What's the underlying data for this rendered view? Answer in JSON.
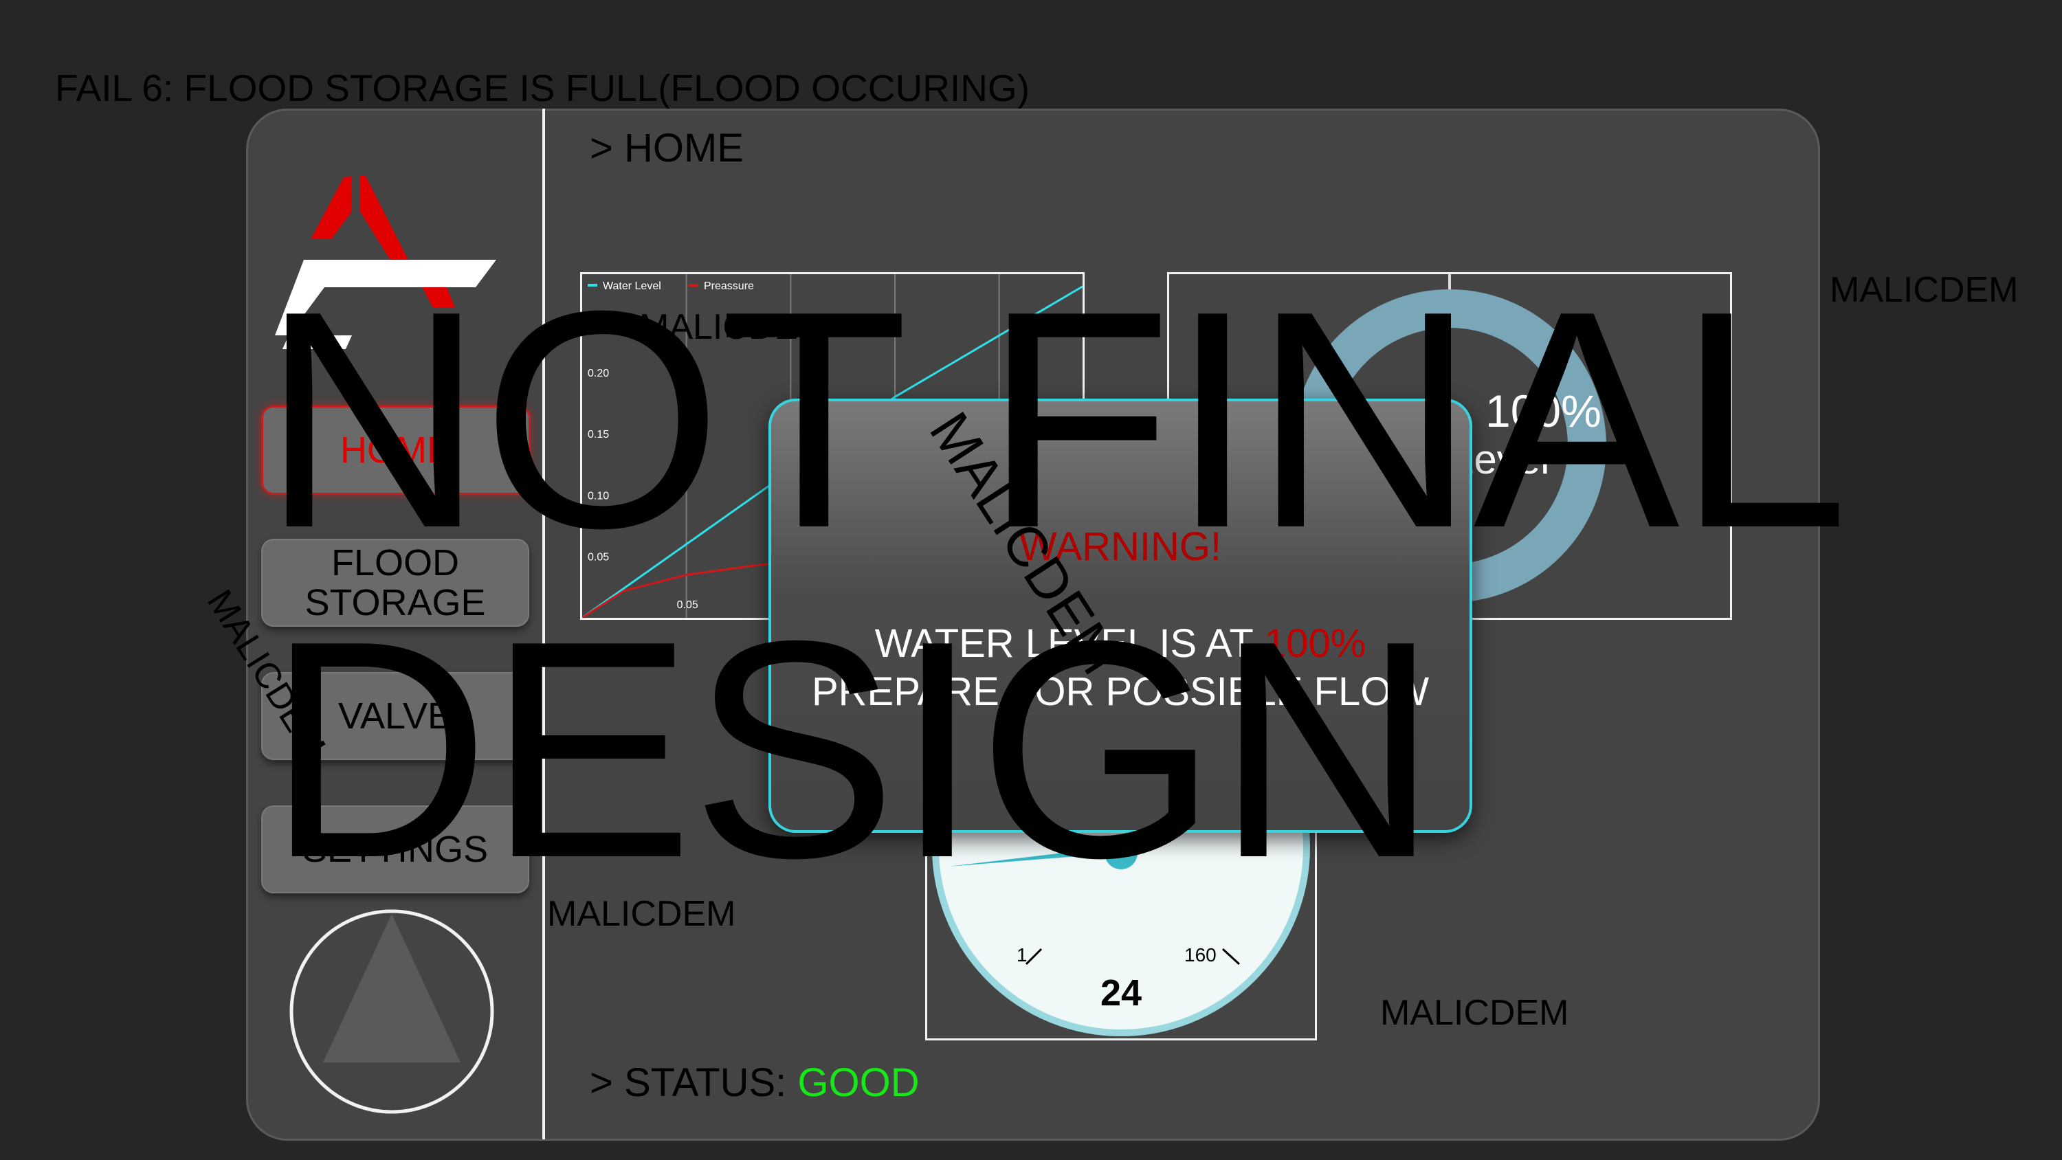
{
  "caption": "FAIL 6: FLOOD STORAGE IS FULL(FLOOD OCCURING)",
  "breadcrumb": "> HOME",
  "sidebar": {
    "logo_icon": "brand-logo-icon",
    "items": [
      {
        "label": "HOME",
        "active": true
      },
      {
        "label": "FLOOD\nSTORAGE",
        "active": false
      },
      {
        "label": "VALVE",
        "active": false
      },
      {
        "label": "SETTINGS",
        "active": false
      }
    ],
    "badge_icon": "triangle-badge-icon"
  },
  "chart_data": {
    "type": "line",
    "series": [
      {
        "name": "Water Level",
        "color": "#2ee0e8",
        "x": [
          0,
          0.05,
          0.1,
          0.15,
          0.24
        ],
        "values": [
          0,
          0.06,
          0.12,
          0.18,
          0.27
        ]
      },
      {
        "name": "Preassure",
        "color": "#d01818",
        "x": [
          0,
          0.02,
          0.05,
          0.08,
          0.1
        ],
        "values": [
          0,
          0.022,
          0.035,
          0.042,
          0.046
        ]
      }
    ],
    "yticks": [
      "0.20",
      "0.15",
      "0.10",
      "0.05"
    ],
    "xticks": [
      "0.05"
    ],
    "ylim": [
      0,
      0.28
    ],
    "xlim": [
      0,
      0.24
    ],
    "grid": true,
    "legend": "top-left"
  },
  "donut": {
    "value_text": "100%",
    "label": "Level",
    "value": 1.0,
    "ring_color": "#7aa7b8",
    "center_icon": "close-circle-icon"
  },
  "gauge": {
    "value": 24,
    "min_label": "1",
    "max_label": "160",
    "value_text": "24"
  },
  "modal": {
    "title": "WARNING!",
    "line1_prefix": "WATER LEVEL IS AT ",
    "line1_value": "100%",
    "line2": "PREPARE FOR POSSIBLE FLOW"
  },
  "status": {
    "prefix": "> STATUS: ",
    "value": "GOOD"
  },
  "watermarks": {
    "small": "MALICDEM",
    "big_line1": "NOT FINAL",
    "big_line2": "DESIGN"
  }
}
